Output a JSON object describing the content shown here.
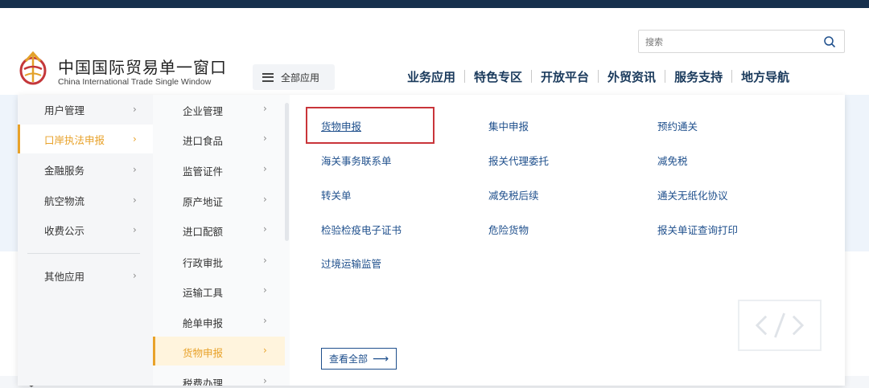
{
  "header": {
    "logo_cn": "中国国际贸易单一窗口",
    "logo_en": "China International Trade Single Window",
    "all_apps_label": "全部应用",
    "search": {
      "placeholder": "搜索"
    },
    "nav": [
      "业务应用",
      "特色专区",
      "开放平台",
      "外贸资讯",
      "服务支持",
      "地方导航"
    ]
  },
  "menu": {
    "categories": [
      {
        "label": "用户管理",
        "chevron": "›"
      },
      {
        "label": "口岸执法申报",
        "chevron": "›"
      },
      {
        "label": "金融服务",
        "chevron": "›"
      },
      {
        "label": "航空物流",
        "chevron": "›"
      },
      {
        "label": "收费公示",
        "chevron": "›"
      },
      {
        "label": "其他应用",
        "chevron": "›"
      }
    ],
    "subcategories": [
      {
        "label": "企业管理",
        "chevron": "›"
      },
      {
        "label": "进口食品",
        "chevron": "›"
      },
      {
        "label": "监管证件",
        "chevron": "›"
      },
      {
        "label": "原产地证",
        "chevron": "›"
      },
      {
        "label": "进口配额",
        "chevron": "›"
      },
      {
        "label": "行政审批",
        "chevron": "›"
      },
      {
        "label": "运输工具",
        "chevron": "›"
      },
      {
        "label": "舱单申报",
        "chevron": "›"
      },
      {
        "label": "货物申报",
        "chevron": "›"
      },
      {
        "label": "税费办理",
        "chevron": "›"
      }
    ],
    "items": [
      [
        "货物申报",
        "集中申报",
        "预约通关"
      ],
      [
        "海关事务联系单",
        "报关代理委托",
        "减免税"
      ],
      [
        "转关单",
        "减免税后续",
        "通关无纸化协议"
      ],
      [
        "检验检疫电子证书",
        "危险货物",
        "报关单证查询打印"
      ],
      [
        "过境运输监管"
      ]
    ],
    "view_all_label": "查看全部",
    "view_all_arrow": "⟶"
  },
  "colors": {
    "accent": "#e8a22a",
    "link": "#1e4f8c",
    "highlight_border": "#c9353a",
    "topbar": "#16304d"
  }
}
